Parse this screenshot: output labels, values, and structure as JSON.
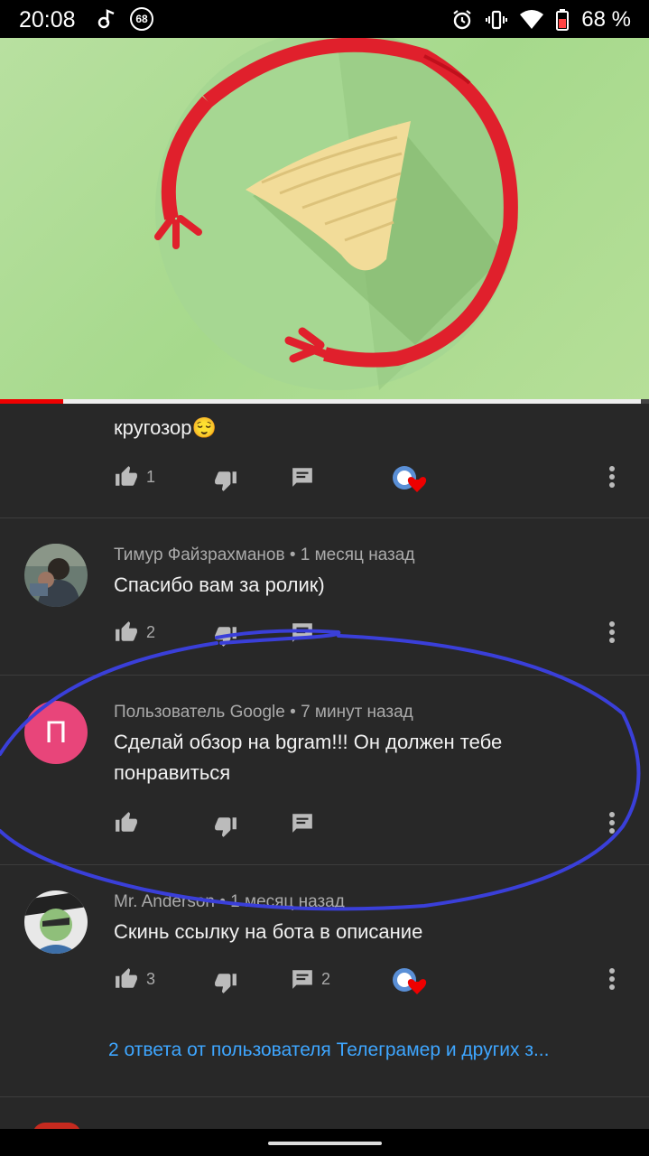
{
  "status_bar": {
    "time": "20:08",
    "badge": "68",
    "battery": "68 %"
  },
  "comments": [
    {
      "text": "кругозор😌",
      "likes": "1",
      "replies": "",
      "creator_heart": true
    },
    {
      "author": "Тимур Файзрахманов",
      "age": "1 месяц назад",
      "text": "Спасибо вам за ролик)",
      "likes": "2",
      "replies": "",
      "creator_heart": false
    },
    {
      "author": "Пользователь Google",
      "age": "7 минут назад",
      "avatar_letter": "П",
      "avatar_color": "#e8457a",
      "text": "Сделай обзор на bgram!!! Он должен тебе понравиться",
      "likes": "",
      "replies": "",
      "creator_heart": false
    },
    {
      "author": "Mr. Anderson",
      "age": "1 месяц назад",
      "text": "Скинь ссылку на бота в описание",
      "likes": "3",
      "replies": "2",
      "creator_heart": true
    }
  ],
  "replies_link": "2 ответа от пользователя Телеграмер и других з...",
  "colors": {
    "background": "#282828",
    "link": "#3ea6ff",
    "annotation": "#3a3fd9"
  },
  "icons": [
    "music-note-icon",
    "alarm-icon",
    "vibrate-icon",
    "wifi-icon",
    "battery-icon",
    "thumbs-up-icon",
    "thumbs-down-icon",
    "reply-icon",
    "creator-heart-icon",
    "more-vert-icon"
  ]
}
